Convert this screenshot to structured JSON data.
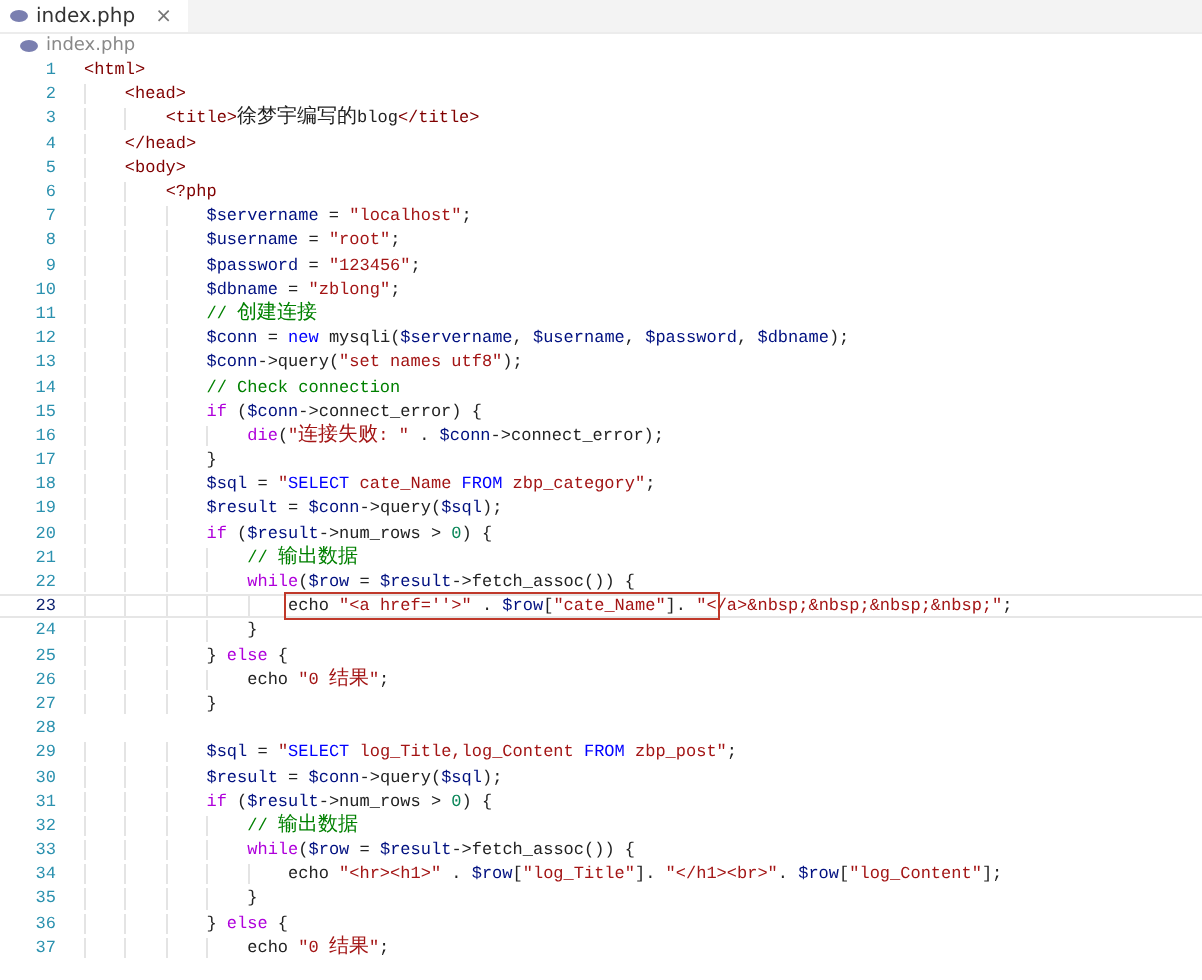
{
  "tabs": [
    {
      "label": "index.php",
      "close": "×",
      "selected": true
    }
  ],
  "breadcrumb": "index.php",
  "editor": {
    "lines": [
      {
        "number": "1",
        "current": false,
        "text": "<html>"
      },
      {
        "number": "2",
        "current": false,
        "text": "    <head>"
      },
      {
        "number": "3",
        "current": false,
        "text": "        <title>徐梦宇编写的blog</title>"
      },
      {
        "number": "4",
        "current": false,
        "text": "    </head>"
      },
      {
        "number": "5",
        "current": false,
        "text": "    <body>"
      },
      {
        "number": "6",
        "current": false,
        "text": "        <?php"
      },
      {
        "number": "7",
        "current": false,
        "text": "            $servername = \"localhost\";"
      },
      {
        "number": "8",
        "current": false,
        "text": "            $username = \"root\";"
      },
      {
        "number": "9",
        "current": false,
        "text": "            $password = \"123456\";"
      },
      {
        "number": "10",
        "current": false,
        "text": "            $dbname = \"zblong\";"
      },
      {
        "number": "11",
        "current": false,
        "text": "            // 创建连接"
      },
      {
        "number": "12",
        "current": false,
        "text": "            $conn = new mysqli($servername, $username, $password, $dbname);"
      },
      {
        "number": "13",
        "current": false,
        "text": "            $conn->query(\"set names utf8\");"
      },
      {
        "number": "14",
        "current": false,
        "text": "            // Check connection"
      },
      {
        "number": "15",
        "current": false,
        "text": "            if ($conn->connect_error) {"
      },
      {
        "number": "16",
        "current": false,
        "text": "                die(\"连接失败: \" . $conn->connect_error);"
      },
      {
        "number": "17",
        "current": false,
        "text": "            }"
      },
      {
        "number": "18",
        "current": false,
        "text": "            $sql = \"SELECT cate_Name FROM zbp_category\";"
      },
      {
        "number": "19",
        "current": false,
        "text": "            $result = $conn->query($sql);"
      },
      {
        "number": "20",
        "current": false,
        "text": "            if ($result->num_rows > 0) {"
      },
      {
        "number": "21",
        "current": false,
        "text": "                // 输出数据"
      },
      {
        "number": "22",
        "current": false,
        "text": "                while($row = $result->fetch_assoc()) {"
      },
      {
        "number": "23",
        "current": true,
        "boxed": "                    echo \"<a href=''>\" . $row[\"cate_Name\"]. \"<",
        "text": "/a>&nbsp;&nbsp;&nbsp;&nbsp;\";"
      },
      {
        "number": "24",
        "current": false,
        "text": "                }"
      },
      {
        "number": "25",
        "current": false,
        "text": "            } else {"
      },
      {
        "number": "26",
        "current": false,
        "text": "                echo \"0 结果\";"
      },
      {
        "number": "27",
        "current": false,
        "text": "            }"
      },
      {
        "number": "28",
        "current": false
      },
      {
        "number": "29",
        "current": false,
        "text": "            $sql = \"SELECT log_Title,log_Content FROM zbp_post\";"
      },
      {
        "number": "30",
        "current": false,
        "text": "            $result = $conn->query($sql);"
      },
      {
        "number": "31",
        "current": false,
        "text": "            if ($result->num_rows > 0) {"
      },
      {
        "number": "32",
        "current": false,
        "text": "                // 输出数据"
      },
      {
        "number": "33",
        "current": false,
        "text": "                while($row = $result->fetch_assoc()) {"
      },
      {
        "number": "34",
        "current": false,
        "text": "                    echo \"<hr><h1>\" . $row[\"log_Title\"]. \"</h1><br>\". $row[\"log_Content\"];"
      },
      {
        "number": "35",
        "current": false,
        "text": "                }"
      },
      {
        "number": "36",
        "current": false,
        "text": "            } else {"
      },
      {
        "number": "37",
        "current": false,
        "text": "                echo \"0 结果\";"
      }
    ]
  }
}
